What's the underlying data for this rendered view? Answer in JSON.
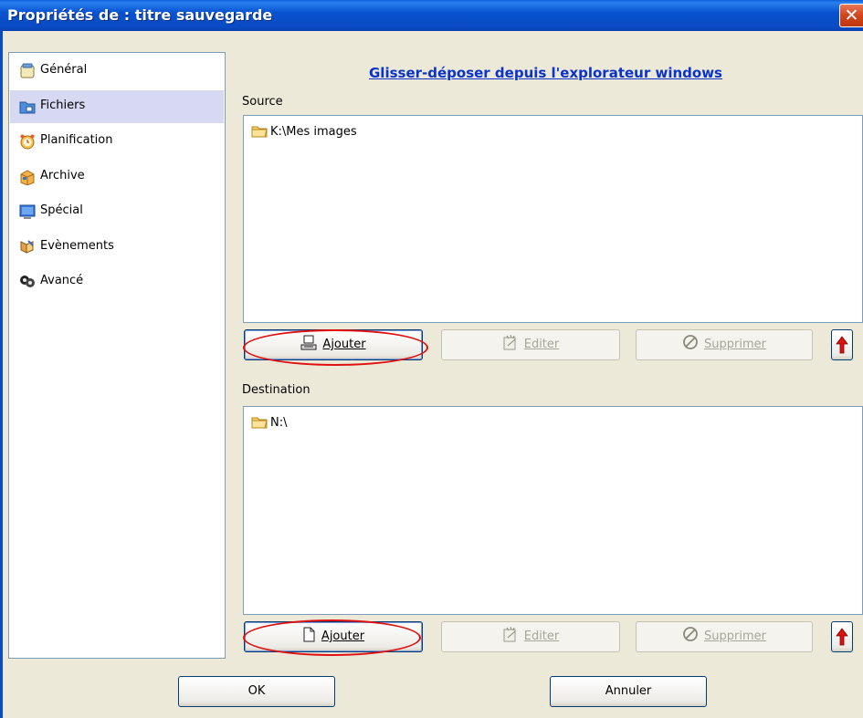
{
  "window": {
    "title": "Propriétés de : titre sauvegarde",
    "close_glyph": "✕"
  },
  "sidebar": {
    "items": [
      {
        "label": "Général",
        "icon": "general-icon",
        "selected": false
      },
      {
        "label": "Fichiers",
        "icon": "files-icon",
        "selected": true
      },
      {
        "label": "Planification",
        "icon": "clock-icon",
        "selected": false
      },
      {
        "label": "Archive",
        "icon": "archive-box-icon",
        "selected": false
      },
      {
        "label": "Spécial",
        "icon": "monitor-icon",
        "selected": false
      },
      {
        "label": "Evènements",
        "icon": "events-icon",
        "selected": false
      },
      {
        "label": "Avancé",
        "icon": "advanced-icon",
        "selected": false
      }
    ]
  },
  "main": {
    "help_link": "Glisser-déposer depuis l'explorateur windows",
    "source": {
      "label": "Source",
      "items": [
        "K:\\Mes images"
      ],
      "buttons": {
        "add": "Ajouter",
        "edit": "Editer",
        "delete": "Supprimer"
      }
    },
    "destination": {
      "label": "Destination",
      "items": [
        "N:\\"
      ],
      "buttons": {
        "add": "Ajouter",
        "edit": "Editer",
        "delete": "Supprimer"
      }
    }
  },
  "footer": {
    "ok": "OK",
    "cancel": "Annuler"
  },
  "colors": {
    "titlebar": "#0853d0",
    "selection": "#d7d9f2",
    "link": "#0a33cc",
    "highlight_ellipse": "#e01010",
    "arrow": "#e01010"
  }
}
